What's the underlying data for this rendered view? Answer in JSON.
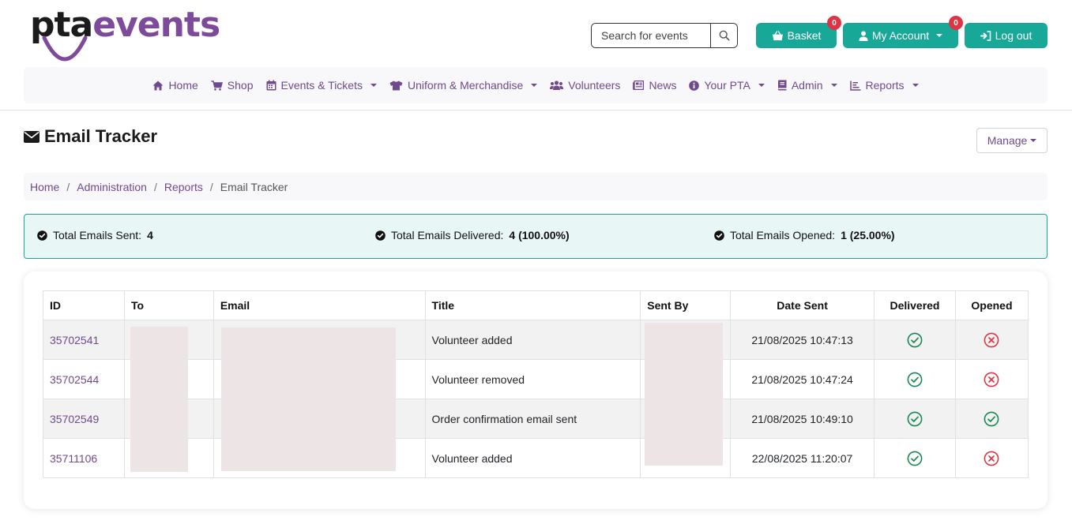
{
  "brand": {
    "part1": "pta",
    "part2": "events"
  },
  "header": {
    "search_placeholder": "Search for events",
    "basket": {
      "label": "Basket",
      "badge": "0"
    },
    "account": {
      "label": "My Account",
      "badge": "0"
    },
    "logout": {
      "label": "Log out"
    }
  },
  "nav": {
    "home": "Home",
    "shop": "Shop",
    "events": "Events & Tickets",
    "uniform": "Uniform & Merchandise",
    "volunteers": "Volunteers",
    "news": "News",
    "your_pta": "Your PTA",
    "admin": "Admin",
    "reports": "Reports"
  },
  "page": {
    "title": "Email Tracker",
    "manage_label": "Manage"
  },
  "breadcrumb": {
    "home": "Home",
    "admin": "Administration",
    "reports": "Reports",
    "current": "Email Tracker"
  },
  "stats": {
    "sent_label": "Total Emails Sent:",
    "sent_value": "4",
    "delivered_label": "Total Emails Delivered:",
    "delivered_value": "4 (100.00%)",
    "opened_label": "Total Emails Opened:",
    "opened_value": "1 (25.00%)"
  },
  "table": {
    "headers": {
      "id": "ID",
      "to": "To",
      "email": "Email",
      "title": "Title",
      "sent_by": "Sent By",
      "date_sent": "Date Sent",
      "delivered": "Delivered",
      "opened": "Opened"
    },
    "rows": [
      {
        "id": "35702541",
        "title": "Volunteer added",
        "date_sent": "21/08/2025 10:47:13",
        "delivered": true,
        "opened": false
      },
      {
        "id": "35702544",
        "title": "Volunteer removed",
        "date_sent": "21/08/2025 10:47:24",
        "delivered": true,
        "opened": false
      },
      {
        "id": "35702549",
        "title": "Order confirmation email sent",
        "date_sent": "21/08/2025 10:49:10",
        "delivered": true,
        "opened": true
      },
      {
        "id": "35711106",
        "title": "Volunteer added",
        "date_sent": "22/08/2025 11:20:07",
        "delivered": true,
        "opened": false
      }
    ]
  },
  "colors": {
    "brand_purple": "#7d4b9a",
    "link_purple": "#6f4a8e",
    "teal": "#17a897",
    "success": "#198754",
    "danger": "#dc3545"
  },
  "icons": {
    "search": "search-icon",
    "basket": "basket-icon",
    "account": "user-icon",
    "logout": "sign-in-icon",
    "home": "home-icon",
    "shop": "cart-icon",
    "events": "calendar-icon",
    "uniform": "shirt-icon",
    "volunteers": "users-icon",
    "news": "newspaper-icon",
    "your_pta": "info-icon",
    "admin": "book-icon",
    "reports": "chart-icon",
    "title": "envelope-icon",
    "stat": "check-circle-icon",
    "delivered": "check-circle-outline-icon",
    "not_opened": "x-circle-outline-icon"
  }
}
